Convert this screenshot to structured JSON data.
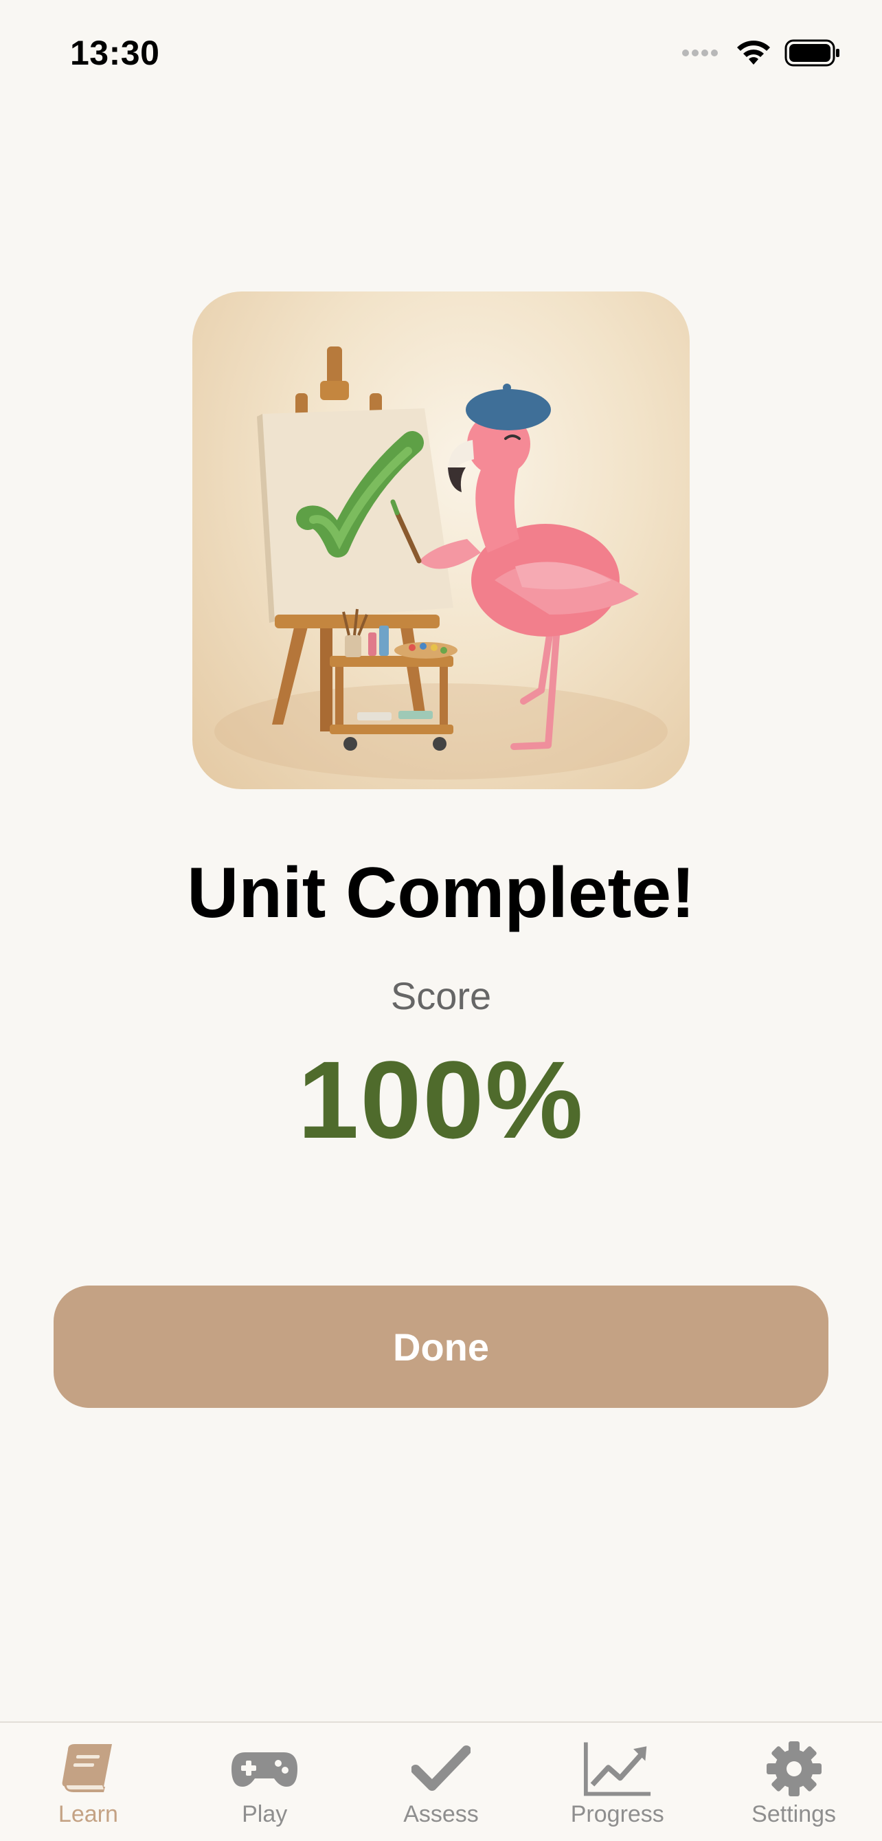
{
  "status_bar": {
    "time": "13:30"
  },
  "completion": {
    "title": "Unit Complete!",
    "score_label": "Score",
    "score_value": "100%"
  },
  "actions": {
    "done_label": "Done"
  },
  "tab_bar": {
    "active": "Learn",
    "items": [
      {
        "label": "Learn",
        "icon": "book-icon"
      },
      {
        "label": "Play",
        "icon": "gamepad-icon"
      },
      {
        "label": "Assess",
        "icon": "checkmark-icon"
      },
      {
        "label": "Progress",
        "icon": "chart-icon"
      },
      {
        "label": "Settings",
        "icon": "gear-icon"
      }
    ]
  },
  "colors": {
    "background": "#f9f7f3",
    "accent": "#c4a284",
    "score": "#4f6b2c",
    "inactive": "#8e8e8e"
  }
}
